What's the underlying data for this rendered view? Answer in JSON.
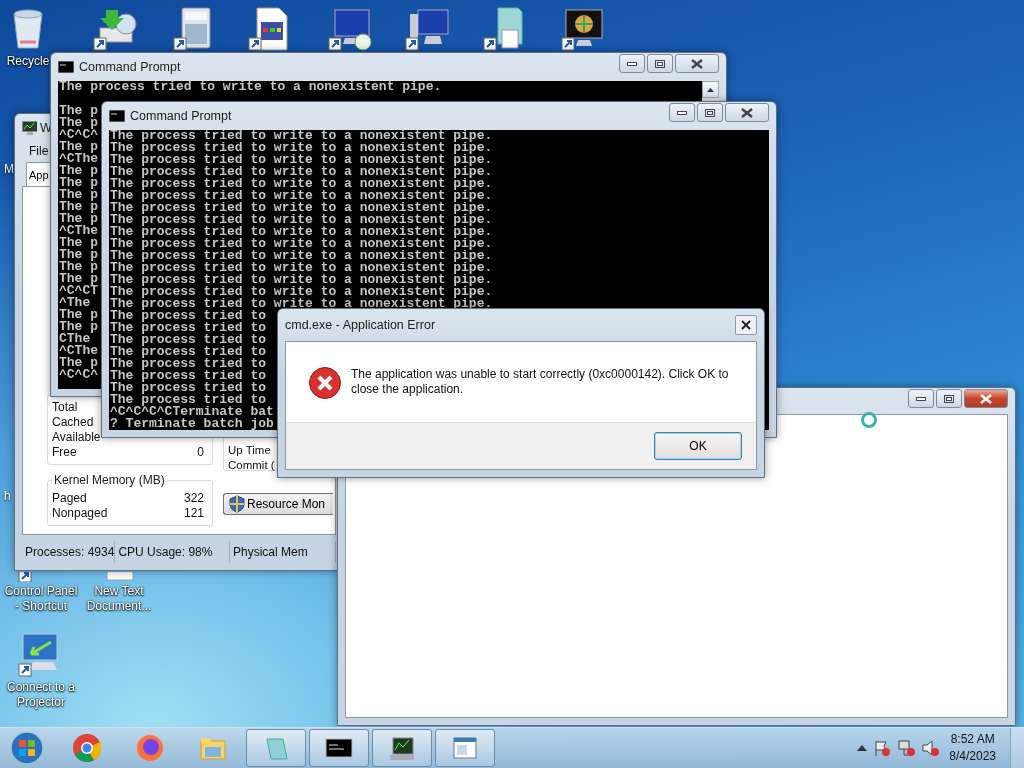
{
  "desktop": {
    "top_icons": [
      {
        "kind": "recycle-bin",
        "label": "Recycle"
      },
      {
        "kind": "installer"
      },
      {
        "kind": "calculator"
      },
      {
        "kind": "calendar-doc"
      },
      {
        "kind": "remote-monitor"
      },
      {
        "kind": "computer"
      },
      {
        "kind": "document"
      },
      {
        "kind": "media-center"
      }
    ],
    "side_icons": [
      {
        "kind": "control-panel",
        "label": "Control Panel - Shortcut"
      },
      {
        "kind": "text-document",
        "label": "New Text Document..."
      },
      {
        "kind": "projector",
        "label": "Connect to a Projector"
      }
    ],
    "partial_labels": [
      "M",
      "h"
    ]
  },
  "task_manager": {
    "title": "W",
    "menu": [
      "File"
    ],
    "tabs": [
      {
        "label": "App",
        "selected": true
      }
    ],
    "physical_memory": [
      {
        "label": "Total"
      },
      {
        "label": "Cached"
      },
      {
        "label": "Available"
      },
      {
        "label": "Free",
        "value": "0"
      }
    ],
    "system": [
      "Up Time",
      "Commit ("
    ],
    "kernel_memory": {
      "title": "Kernel Memory (MB)",
      "rows": [
        {
          "label": "Paged",
          "value": "322"
        },
        {
          "label": "Nonpaged",
          "value": "121"
        }
      ]
    },
    "resource_button": "Resource Mon",
    "status_bar": [
      "Processes: 4934",
      "CPU Usage: 98%",
      "Physical Mem"
    ]
  },
  "cmd_back": {
    "title": "Command Prompt",
    "lines": [
      "The process tried to write to a nonexistent pipe.",
      "The p",
      "The p",
      "^C^C^",
      "The p",
      "^CThe",
      "The p",
      "The p",
      "The p",
      "The p",
      "The p",
      "^CThe",
      "The p",
      "The p",
      "The p",
      "The p",
      "^C^CT",
      "^The",
      "The p",
      "The p",
      "CThe",
      "^CThe",
      "The p",
      "^C^C^"
    ]
  },
  "cmd_front": {
    "title": "Command Prompt",
    "lines": [
      "The process tried to write to a nonexistent pipe.",
      "The process tried to write to a nonexistent pipe.",
      "The process tried to write to a nonexistent pipe.",
      "The process tried to write to a nonexistent pipe.",
      "The process tried to write to a nonexistent pipe.",
      "The process tried to write to a nonexistent pipe.",
      "The process tried to write to a nonexistent pipe.",
      "The process tried to write to a nonexistent pipe.",
      "The process tried to write to a nonexistent pipe.",
      "The process tried to write to a nonexistent pipe.",
      "The process tried to write to a nonexistent pipe.",
      "The process tried to write to a nonexistent pipe.",
      "The process tried to write to a nonexistent pipe.",
      "The process tried to write to a nonexistent pipe.",
      "The process tried to write to a nonexistent pipe.",
      "The process tried to",
      "The process tried to",
      "The process tried to",
      "The process tried to",
      "The process tried to",
      "The process tried to",
      "The process tried to",
      "The process tried to",
      "^C^C^C^CTerminate bat",
      "? Terminate batch job"
    ]
  },
  "dialog": {
    "title": "cmd.exe - Application Error",
    "message": "The application was unable to start correctly (0xc0000142). Click OK to close the application.",
    "button": "OK"
  },
  "taskbar": {
    "items": [
      {
        "kind": "start",
        "open": false
      },
      {
        "kind": "chrome",
        "open": false
      },
      {
        "kind": "firefox",
        "open": false
      },
      {
        "kind": "explorer",
        "open": false
      },
      {
        "kind": "notepad",
        "open": true
      },
      {
        "kind": "cmd",
        "open": true
      },
      {
        "kind": "taskmgr",
        "open": true
      },
      {
        "kind": "window",
        "open": true
      }
    ],
    "time": "8:52 AM",
    "date": "8/4/2023"
  }
}
